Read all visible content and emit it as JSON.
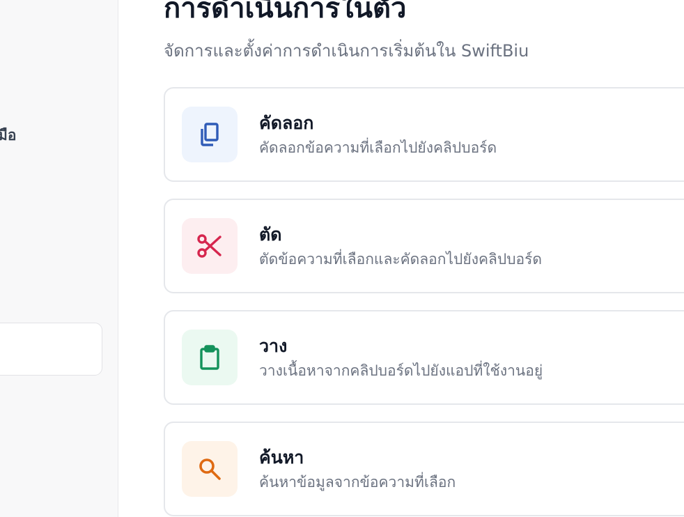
{
  "sidebar": {
    "partial_label": "มือ"
  },
  "header": {
    "title": "การดำเนินการในตัว",
    "subtitle": "จัดการและตั้งค่าการดำเนินการเริ่มต้นใน SwiftBiu"
  },
  "actions": [
    {
      "title": "คัดลอก",
      "description": "คัดลอกข้อความที่เลือกไปยังคลิปบอร์ด",
      "icon": "copy-icon",
      "color": "#2f5bb7",
      "tile_bg": "#eef4fd"
    },
    {
      "title": "ตัด",
      "description": "ตัดข้อความที่เลือกและคัดลอกไปยังคลิปบอร์ด",
      "icon": "scissors-icon",
      "color": "#d6264e",
      "tile_bg": "#fdeef0"
    },
    {
      "title": "วาง",
      "description": "วางเนื้อหาจากคลิปบอร์ดไปยังแอปที่ใช้งานอยู่",
      "icon": "clipboard-icon",
      "color": "#14925b",
      "tile_bg": "#ebf9f1"
    },
    {
      "title": "ค้นหา",
      "description": "ค้นหาข้อมูลจากข้อความที่เลือก",
      "icon": "search-icon",
      "color": "#df6a12",
      "tile_bg": "#fef3e8"
    }
  ]
}
